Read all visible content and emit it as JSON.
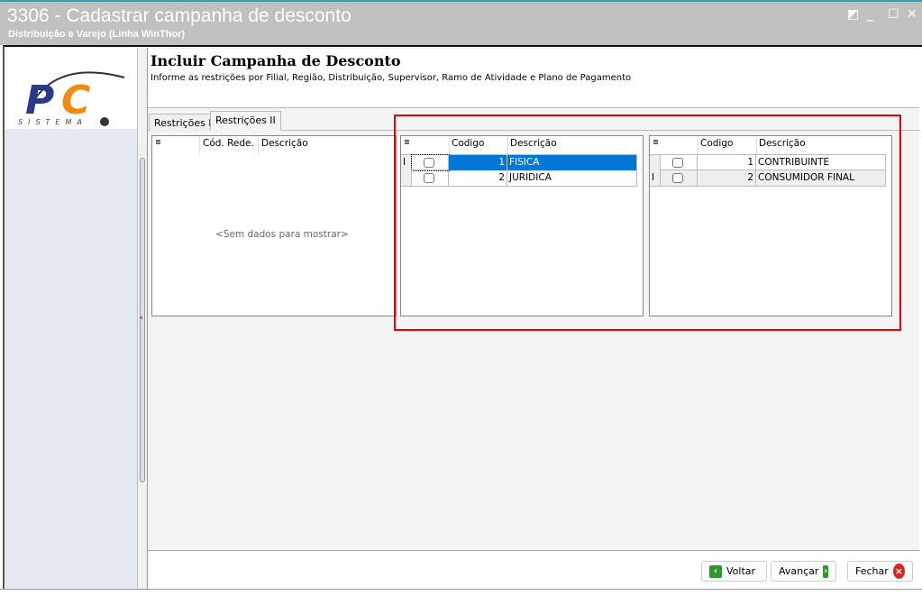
{
  "window": {
    "title": "3306 - Cadastrar campanha de desconto",
    "subtitle": "Distribuição e Varejo (Linha WinThor)",
    "controls": [
      "restore-icon",
      "minimize-icon",
      "maximize-icon",
      "close-icon"
    ]
  },
  "logo": {
    "text": "PC",
    "tagline": "SISTEMAS"
  },
  "header": {
    "title": "Incluir Campanha de Desconto",
    "description": "Informe as restrições por Filial, Região, Distribuição, Supervisor, Ramo de Atividade e Plano de Pagamento"
  },
  "tabs": [
    {
      "label": "Restrições I",
      "active": false
    },
    {
      "label": "Restrições II",
      "active": true
    }
  ],
  "grid1": {
    "columns": [
      "Cód. Rede.",
      "Descrição"
    ],
    "empty_text": "<Sem dados para mostrar>"
  },
  "grid2": {
    "columns": [
      "Codigo",
      "Descrição"
    ],
    "rows": [
      {
        "codigo": "1",
        "descricao": "FISICA",
        "selected": true,
        "checked": false
      },
      {
        "codigo": "2",
        "descricao": "JURIDICA",
        "selected": false,
        "checked": false
      }
    ]
  },
  "grid3": {
    "columns": [
      "Codigo",
      "Descrição"
    ],
    "rows": [
      {
        "codigo": "1",
        "descricao": "CONTRIBUINTE",
        "checked": false
      },
      {
        "codigo": "2",
        "descricao": "CONSUMIDOR FINAL",
        "checked": false,
        "current": true
      }
    ]
  },
  "buttons": {
    "back": "Voltar",
    "next": "Avançar",
    "close": "Fechar"
  },
  "colors": {
    "selection": "#0078d7",
    "highlight": "#e00000",
    "titlebar": "#c0c0c0"
  }
}
